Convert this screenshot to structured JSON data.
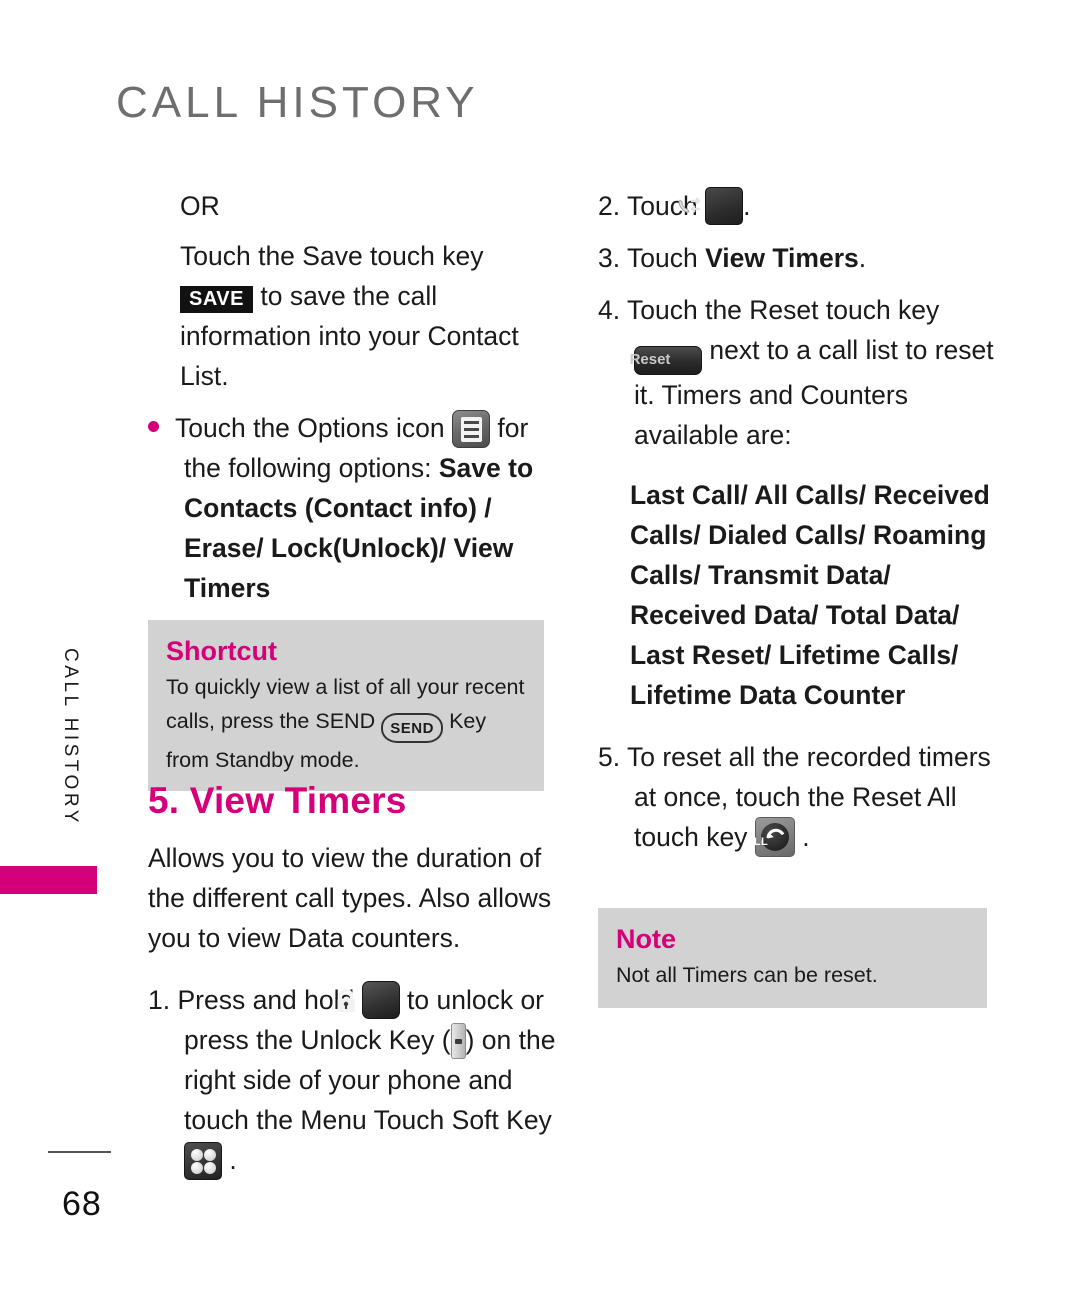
{
  "page": {
    "header_title": "CALL HISTORY",
    "side_tab_label": "CALL HISTORY",
    "page_number": "68",
    "accent_color": "#d4007a",
    "header_color": "#6e6e6e",
    "callout_bg_color": "#d2d2d2"
  },
  "left_column": {
    "or_label": "OR",
    "save_step": {
      "text_before": "Touch the Save touch key",
      "icon_label": "SAVE",
      "text_after": "to save the call information into your Contact List."
    },
    "options_bullet": {
      "text_before": "Touch the Options icon",
      "icon_name": "options-icon",
      "text_after": "for the following options:",
      "options_bold": "Save to Contacts (Contact info) / Erase/ Lock(Unlock)/ View Timers"
    },
    "shortcut_box": {
      "title": "Shortcut",
      "text_before": "To quickly view a list of all your recent calls, press the SEND",
      "key_label": "SEND",
      "text_after": "Key from Standby mode."
    },
    "section_heading": "5. View Timers",
    "section_intro": "Allows you to view the duration of the different call types. Also allows you to view Data counters.",
    "step_1": {
      "number": "1.",
      "text_a": "Press and hold",
      "lock_icon_name": "lock-icon",
      "text_b": "to unlock or press the Unlock Key (",
      "unlock_icon_name": "unlock-key-icon",
      "text_c": ") on the right side of your phone and touch the Menu Touch Soft Key",
      "menu_icon_name": "menu-soft-key-icon",
      "text_d": "."
    }
  },
  "right_column": {
    "step_2": {
      "number": "2.",
      "text_a": "Touch",
      "icon_name": "call-history-icon",
      "text_b": "."
    },
    "step_3": {
      "number": "3.",
      "text_a": "Touch ",
      "bold_text": "View Timers",
      "text_b": "."
    },
    "step_4": {
      "number": "4.",
      "text_a": "Touch the Reset touch key",
      "icon_label": "Reset",
      "text_b": "next to a call list to reset it. Timers and Counters available are:"
    },
    "timers_list_bold": "Last Call/ All Calls/ Received Calls/ Dialed Calls/ Roaming Calls/ Transmit Data/ Received Data/ Total Data/ Last Reset/ Lifetime Calls/ Lifetime Data Counter",
    "step_5": {
      "number": "5.",
      "text_a": "To reset all the recorded timers at once, touch the Reset All touch key",
      "icon_name": "reset-all-icon",
      "icon_label": "ALL",
      "text_b": "."
    },
    "note_box": {
      "title": "Note",
      "body": "Not all Timers can be reset."
    }
  }
}
